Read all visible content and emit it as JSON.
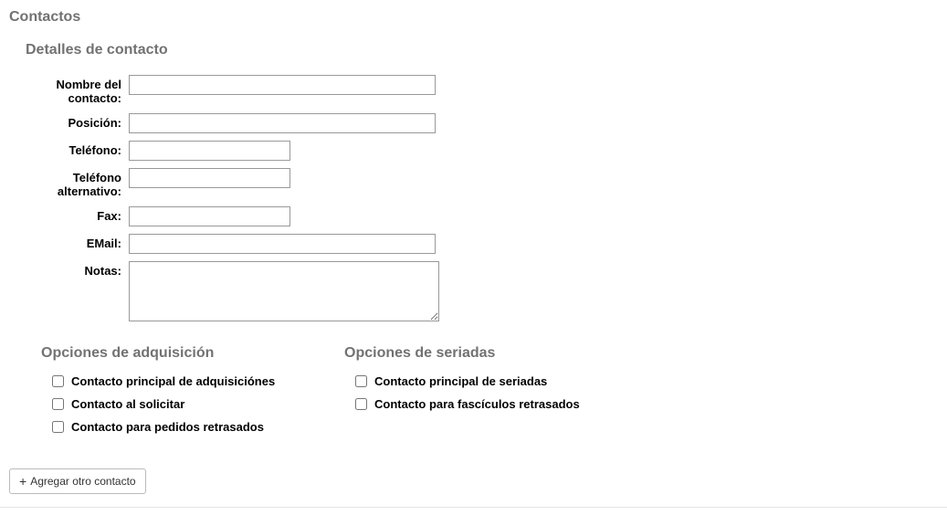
{
  "section_title": "Contactos",
  "subsection_title": "Detalles de contacto",
  "fields": {
    "name": {
      "label": "Nombre del contacto:",
      "value": ""
    },
    "position": {
      "label": "Posición:",
      "value": ""
    },
    "phone": {
      "label": "Teléfono:",
      "value": ""
    },
    "altphone": {
      "label": "Teléfono alternativo:",
      "value": ""
    },
    "fax": {
      "label": "Fax:",
      "value": ""
    },
    "email": {
      "label": "EMail:",
      "value": ""
    },
    "notes": {
      "label": "Notas:",
      "value": ""
    }
  },
  "acquisition": {
    "title": "Opciones de adquisición",
    "options": [
      "Contacto principal de adquisiciónes",
      "Contacto al solicitar",
      "Contacto para pedidos retrasados"
    ]
  },
  "serials": {
    "title": "Opciones de seriadas",
    "options": [
      "Contacto principal de seriadas",
      "Contacto para fascículos retrasados"
    ]
  },
  "add_button_label": "Agregar otro contacto"
}
